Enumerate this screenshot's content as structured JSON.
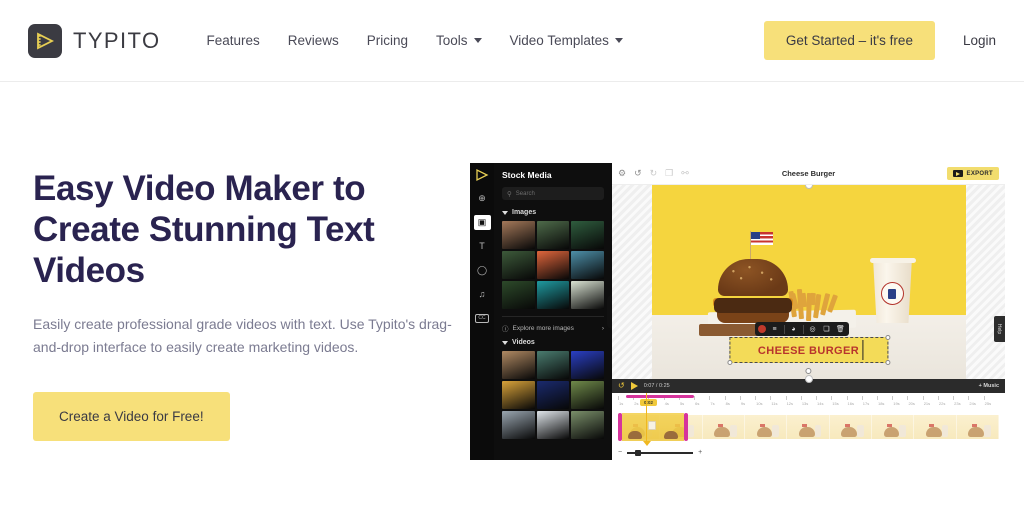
{
  "header": {
    "brand": {
      "name": "TYPITO",
      "icon": "typito-play-logo-icon"
    },
    "nav": [
      {
        "label": "Features",
        "has_caret": false
      },
      {
        "label": "Reviews",
        "has_caret": false
      },
      {
        "label": "Pricing",
        "has_caret": false
      },
      {
        "label": "Tools",
        "has_caret": true
      },
      {
        "label": "Video Templates",
        "has_caret": true
      }
    ],
    "cta_label": "Get Started – it's free",
    "login_label": "Login",
    "accent_yellow": "#f7e07a"
  },
  "hero": {
    "title": "Easy Video Maker to Create Stunning Text Videos",
    "subtitle": "Easily create professional grade videos with text. Use Typito's drag-and-drop interface to easily create marketing videos.",
    "cta_label": "Create a Video for Free!",
    "title_color": "#2a2350"
  },
  "app": {
    "rail": [
      {
        "name": "logo-icon",
        "glyph": "▷"
      },
      {
        "name": "add-media-icon",
        "glyph": "⊕"
      },
      {
        "name": "video-clips-icon",
        "glyph": "▣",
        "active": true
      },
      {
        "name": "text-icon",
        "glyph": "T"
      },
      {
        "name": "shapes-icon",
        "glyph": "◯"
      },
      {
        "name": "music-icon",
        "glyph": "♫"
      },
      {
        "name": "captions-icon",
        "glyph": "CC"
      }
    ],
    "panel": {
      "title": "Stock Media",
      "search_placeholder": "Search",
      "sections": [
        {
          "label": "Images",
          "expanded": true
        },
        {
          "label": "Videos",
          "expanded": true
        }
      ],
      "explore_label": "Explore more images",
      "explore_arrow": "›",
      "image_thumbs": [
        "#a4795a",
        "#4e6b4a",
        "#2f5d3e",
        "#3d5a3a",
        "#e0663c",
        "#4d8fa8",
        "#2d4a2a",
        "#1f9aa0",
        "#d9e2d2"
      ],
      "video_thumbs": [
        "#b08a63",
        "#4a7c6f",
        "#2a3fc4",
        "#d9a33a",
        "#1a2a6e",
        "#6f8a4a",
        "#9aa6b0",
        "#dfe5ea",
        "#7a8f6a"
      ]
    },
    "editor": {
      "toolbar_icons": [
        {
          "name": "settings-gear-icon",
          "glyph": "⚙"
        },
        {
          "name": "undo-icon",
          "glyph": "↺"
        },
        {
          "name": "redo-icon",
          "glyph": "↻"
        },
        {
          "name": "duplicate-icon",
          "glyph": "❐"
        },
        {
          "name": "link-icon",
          "glyph": "⚯"
        }
      ],
      "project_title": "Cheese Burger",
      "export_label": "EXPORT",
      "export_color": "#f2dd6e"
    },
    "canvas": {
      "overlay_text": "CHEESE BURGER",
      "overlay_bg": "#f3db58",
      "overlay_text_color": "#b8342d",
      "background_color": "#f5d53e",
      "float_toolbar": [
        {
          "name": "color-swatch-icon",
          "glyph": ""
        },
        {
          "name": "align-icon",
          "glyph": "≡"
        },
        {
          "name": "opacity-icon",
          "glyph": "◕"
        },
        {
          "name": "zoom-icon",
          "glyph": "◎"
        },
        {
          "name": "duplicate-layer-icon",
          "glyph": "❏"
        },
        {
          "name": "delete-icon",
          "glyph": "🗑"
        }
      ],
      "help_label": "Help"
    },
    "playbar": {
      "loop_icon": "↺",
      "play_icon": "play-triangle",
      "current_time": "0:07",
      "total_time": "0:25",
      "time_display": "0:07 / 0:25",
      "music_label": "+ Music"
    },
    "timeline": {
      "clip_badge": "0:02",
      "ticks": [
        "1s",
        "2s",
        "3s",
        "4s",
        "5s",
        "6s",
        "7s",
        "8s",
        "9s",
        "10s",
        "11s",
        "12s",
        "13s",
        "14s",
        "15s",
        "16s",
        "17s",
        "18s",
        "19s",
        "20s",
        "21s",
        "22s",
        "23s",
        "24s",
        "25s"
      ],
      "selection_color": "#d6349c",
      "strip_color": "#f7e9bd",
      "zoom_minus": "−",
      "zoom_plus": "+"
    }
  }
}
